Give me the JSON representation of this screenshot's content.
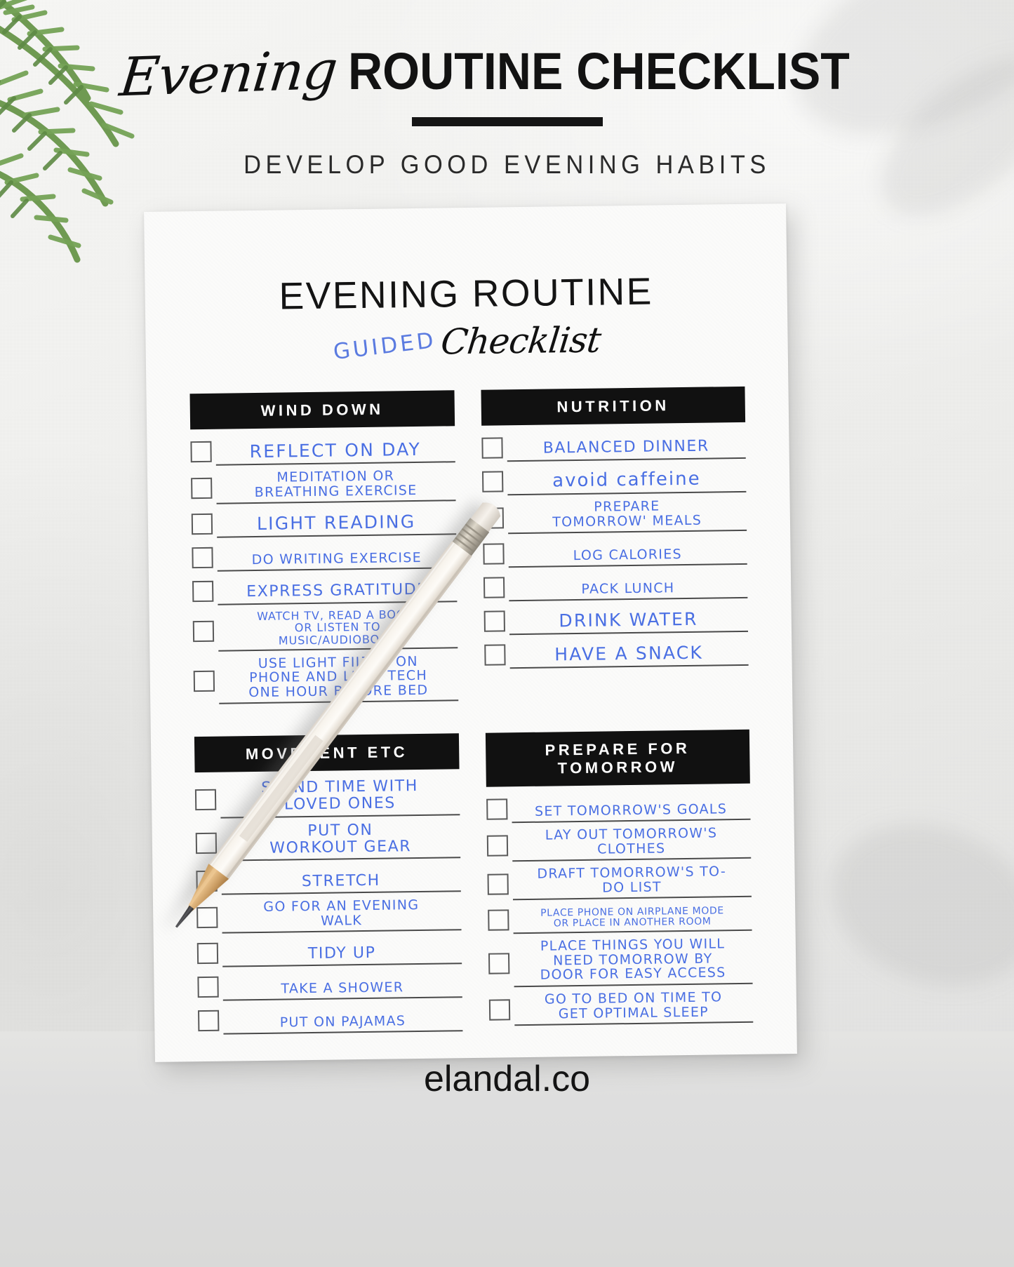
{
  "header": {
    "title_script": "Evening",
    "title_bold": "ROUTINE CHECKLIST",
    "subtitle": "DEVELOP GOOD EVENING HABITS"
  },
  "document": {
    "title": "EVENING ROUTINE",
    "subtitle_accent": "GUIDED",
    "subtitle_script": "Checklist",
    "accent_color": "#4a6fe3",
    "header_bg": "#111111",
    "sections": [
      {
        "id": "wind-down",
        "title": "WIND DOWN",
        "items": [
          {
            "text": "REFLECT ON DAY",
            "size": "sz-xl"
          },
          {
            "text": "MEDITATION OR\nBREATHING EXERCISE",
            "size": "sz-md"
          },
          {
            "text": "LIGHT READING",
            "size": "sz-xl"
          },
          {
            "text": "DO WRITING EXERCISE",
            "size": "sz-md"
          },
          {
            "text": "EXPRESS GRATITUDE",
            "size": "sz-lg"
          },
          {
            "text": "WATCH TV, READ A BOOK,\nOR LISTEN TO\nMUSIC/AUDIOBOOK",
            "size": "sz-sm"
          },
          {
            "text": "USE LIGHT FILTER ON\nPHONE AND LIMIT TECH\nONE HOUR BEFORE BED",
            "size": "sz-md"
          }
        ]
      },
      {
        "id": "nutrition",
        "title": "NUTRITION",
        "items": [
          {
            "text": "BALANCED DINNER",
            "size": "sz-lg"
          },
          {
            "text": "avoid caffeine",
            "size": "lower"
          },
          {
            "text": "PREPARE\nTOMORROW' MEALS",
            "size": "sz-md"
          },
          {
            "text": "LOG CALORIES",
            "size": "sz-md"
          },
          {
            "text": "PACK LUNCH",
            "size": "sz-md"
          },
          {
            "text": "DRINK WATER",
            "size": "sz-xl"
          },
          {
            "text": "HAVE A SNACK",
            "size": "sz-xl"
          }
        ]
      },
      {
        "id": "movement-etc",
        "title": "MOVEMENT ETC",
        "items": [
          {
            "text": "SPEND TIME WITH\nLOVED ONES",
            "size": "sz-lg"
          },
          {
            "text": "PUT ON\nWORKOUT GEAR",
            "size": "sz-lg"
          },
          {
            "text": "STRETCH",
            "size": "sz-lg"
          },
          {
            "text": "GO FOR AN EVENING\nWALK",
            "size": "sz-md"
          },
          {
            "text": "TIDY UP",
            "size": "sz-lg"
          },
          {
            "text": "TAKE A SHOWER",
            "size": "sz-md"
          },
          {
            "text": "PUT ON PAJAMAS",
            "size": "sz-md"
          }
        ]
      },
      {
        "id": "prepare-for-tomorrow",
        "title": "PREPARE FOR TOMORROW",
        "items": [
          {
            "text": "SET TOMORROW'S GOALS",
            "size": "sz-md"
          },
          {
            "text": "LAY OUT TOMORROW'S\nCLOTHES",
            "size": "sz-md"
          },
          {
            "text": "DRAFT TOMORROW'S TO-\nDO LIST",
            "size": "sz-md"
          },
          {
            "text": "PLACE PHONE ON AIRPLANE MODE\nOR PLACE IN ANOTHER ROOM",
            "size": "sz-xs"
          },
          {
            "text": "PLACE THINGS YOU WILL\nNEED TOMORROW BY\nDOOR FOR EASY ACCESS",
            "size": "sz-md"
          },
          {
            "text": "GO TO BED ON TIME TO\nGET OPTIMAL SLEEP",
            "size": "sz-md"
          }
        ]
      }
    ]
  },
  "footer": {
    "website": "elandal.co"
  }
}
